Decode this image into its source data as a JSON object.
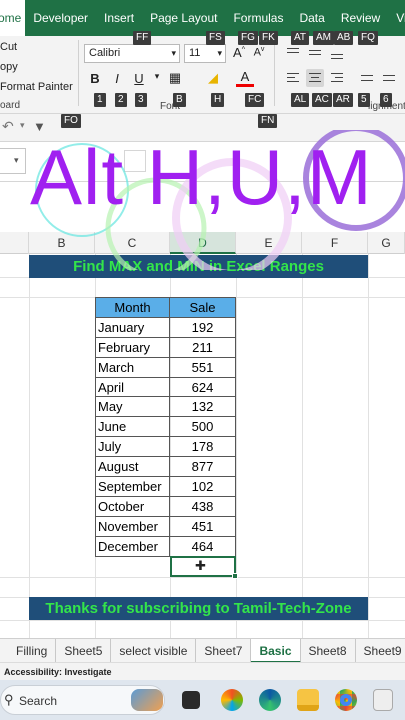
{
  "ribbon_tabs": [
    "ome",
    "Developer",
    "Insert",
    "Page Layout",
    "Formulas",
    "Data",
    "Review",
    "View"
  ],
  "keytips": {
    "ff": "FF",
    "fs": "FS",
    "fg": "FG",
    "fk": "FK",
    "at": "AT",
    "am": "AM",
    "ab": "AB",
    "fq": "FQ",
    "k1": "1",
    "k2": "2",
    "k3": "3",
    "b": "B",
    "h": "H",
    "fc": "FC",
    "al": "AL",
    "ac": "AC",
    "ar": "AR",
    "k5": "5",
    "k6": "6",
    "fo": "FO",
    "fn": "FN"
  },
  "clipboard": {
    "cut": "Cut",
    "copy": "opy",
    "painter": "Format Painter",
    "label": "oard"
  },
  "font": {
    "name": "Calibri",
    "size": "11",
    "label": "Font",
    "bold": "B",
    "italic": "I",
    "underline": "U",
    "color": "A"
  },
  "alignment_label": "lignment",
  "overlay_text": "Alt H,U,M",
  "columns": [
    "B",
    "C",
    "D",
    "E",
    "F",
    "G"
  ],
  "banner_title": "Find MAX and MIN in Excel Ranges",
  "table": {
    "headers": [
      "Month",
      "Sale"
    ],
    "rows": [
      [
        "January",
        "192"
      ],
      [
        "February",
        "211"
      ],
      [
        "March",
        "551"
      ],
      [
        "April",
        "624"
      ],
      [
        "May",
        "132"
      ],
      [
        "June",
        "500"
      ],
      [
        "July",
        "178"
      ],
      [
        "August",
        "877"
      ],
      [
        "September",
        "102"
      ],
      [
        "October",
        "438"
      ],
      [
        "November",
        "451"
      ],
      [
        "December",
        "464"
      ]
    ]
  },
  "footer_banner": "Thanks for subscribing to Tamil-Tech-Zone",
  "sheets": [
    "Filling",
    "Sheet5",
    "select visible",
    "Sheet7",
    "Basic",
    "Sheet8",
    "Sheet9"
  ],
  "active_sheet": "Basic",
  "status_text": "Accessibility: Investigate",
  "search_placeholder": "Search",
  "colors": {
    "excel_green": "#1f7145",
    "banner_bg": "#1f4e79",
    "banner_text": "#33e54a",
    "header_blue": "#5aaee8",
    "overlay_purple": "#a020f0"
  }
}
